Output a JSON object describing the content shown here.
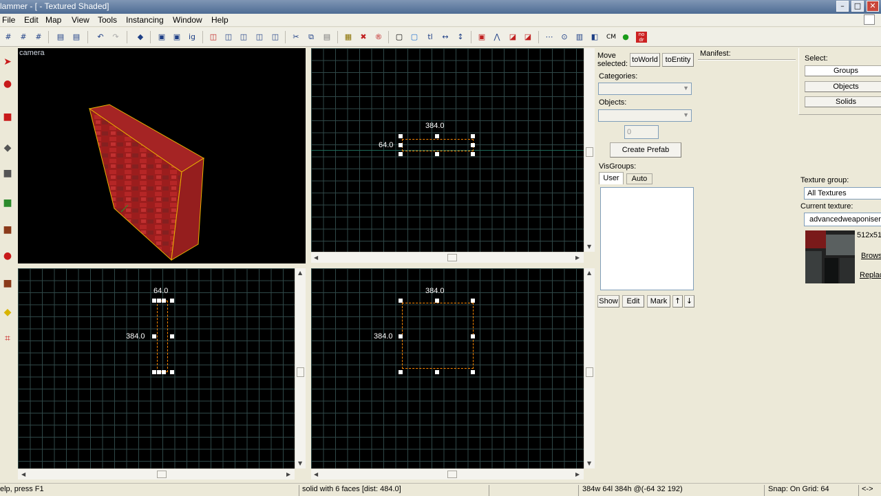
{
  "window": {
    "title": "lammer - [ - Textured Shaded]",
    "min": "–",
    "max": "□",
    "close": "✕"
  },
  "menu": [
    "File",
    "Edit",
    "Map",
    "View",
    "Tools",
    "Instancing",
    "Window",
    "Help"
  ],
  "toolbar_icons": {
    "undo": "↶",
    "redo": "↷",
    "cut": "✂",
    "copy": "⧉",
    "paste": "▤",
    "cm": "CM"
  },
  "viewports": {
    "camera": {
      "label": "camera"
    },
    "top": {
      "width_label": "384.0",
      "height_label": "64.0"
    },
    "side": {
      "width_label": "64.0",
      "height_label": "384.0"
    },
    "front": {
      "width_label": "384.0",
      "height_label": "384.0"
    }
  },
  "object_panel": {
    "move_selected": "Move selected:",
    "to_world": "toWorld",
    "to_entity": "toEntity",
    "categories_label": "Categories:",
    "objects_label": "Objects:",
    "spin_value": "0",
    "create_prefab": "Create Prefab",
    "visgroups_label": "VisGroups:",
    "tab_user": "User",
    "tab_auto": "Auto",
    "show": "Show",
    "edit": "Edit",
    "mark": "Mark",
    "up": "↑",
    "down": "↓"
  },
  "manifest": {
    "label": "Manifest:"
  },
  "select_panel": {
    "label": "Select:",
    "groups": "Groups",
    "objects": "Objects",
    "solids": "Solids"
  },
  "texture_panel": {
    "group_label": "Texture group:",
    "group_value": "All Textures",
    "current_label": "Current texture:",
    "current_value": "advancedweaponiser/",
    "size": "512x51",
    "browse": "Brows",
    "replace": "Replac"
  },
  "status": {
    "help": "elp, press F1",
    "selection": "solid with 6 faces  [dist: 484.0]",
    "dims": "384w 64l 384h @(-64 32 192)",
    "snap": "Snap: On Grid: 64",
    "arrows": "<->"
  }
}
